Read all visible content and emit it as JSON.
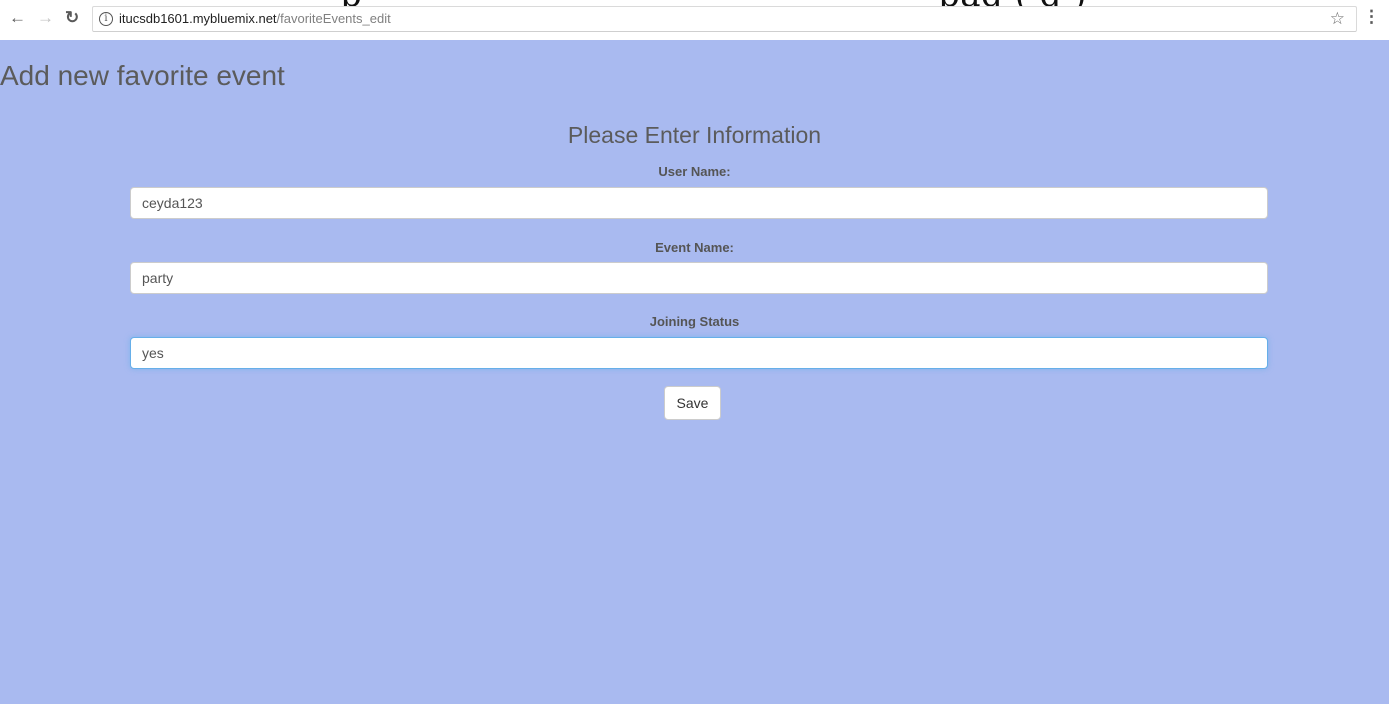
{
  "browser": {
    "url_host": "itucsdb1601.mybluemix.net",
    "url_path": "/favoriteEvents_edit",
    "bleed_left": "p",
    "bleed_right": "pag  (  g        )"
  },
  "page": {
    "title": "Add new favorite event",
    "form_heading": "Please Enter Information"
  },
  "form": {
    "user_name": {
      "label": "User Name:",
      "value": "ceyda123"
    },
    "event_name": {
      "label": "Event Name:",
      "value": "party"
    },
    "joining_status": {
      "label": "Joining Status",
      "value": "yes"
    },
    "save_label": "Save"
  },
  "icons": {
    "back": "back-arrow-icon",
    "forward": "forward-arrow-icon",
    "reload": "reload-icon",
    "info": "info-icon",
    "star": "star-icon",
    "menu": "menu-icon"
  },
  "colors": {
    "page_background": "#a9baf0",
    "focus_ring": "#66afe9"
  }
}
